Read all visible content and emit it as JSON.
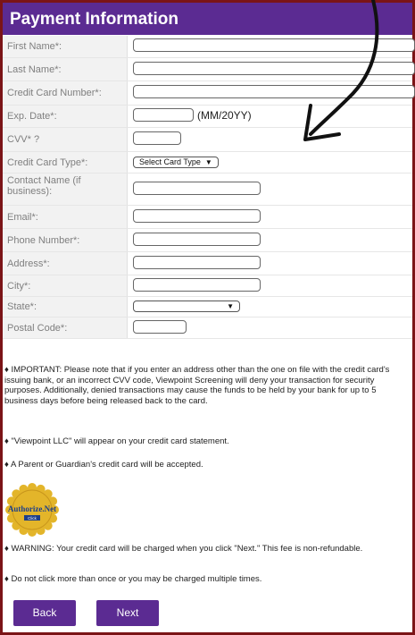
{
  "header": {
    "title": "Payment Information"
  },
  "fields": {
    "first_name": "First Name*:",
    "last_name": "Last Name*:",
    "card_number": "Credit Card Number*:",
    "exp_date": "Exp. Date*:",
    "exp_hint": "(MM/20YY)",
    "cvv": "CVV* ?",
    "card_type": "Credit Card Type*:",
    "card_type_selected": "Select Card Type",
    "contact_name": "Contact Name (if business):",
    "email": "Email*:",
    "phone": "Phone Number*:",
    "address": "Address*:",
    "city": "City*:",
    "state": "State*:",
    "postal": "Postal Code*:"
  },
  "notes": {
    "important": "♦ IMPORTANT: Please note that if you enter an address other than the one on file with the credit card's issuing bank, or an incorrect CVV code, Viewpoint Screening will deny your transaction for security purposes. Additionally, denied transactions may cause the funds to be held by your bank for up to 5 business days before being released back to the card.",
    "statement": "♦ \"Viewpoint LLC\" will appear on your credit card statement.",
    "guardian": "♦ A Parent or Guardian's credit card will be accepted.",
    "warning": "♦ WARNING: Your credit card will be charged when you click \"Next.\" This fee is non-refundable.",
    "once": "♦ Do not click more than once or you may be charged multiple times."
  },
  "badge": {
    "line1": "Authorize.Net",
    "line2": "Click"
  },
  "buttons": {
    "back": "Back",
    "next": "Next"
  },
  "colors": {
    "header": "#5b2b92",
    "button": "#5b2b92",
    "frame": "#7b1417",
    "badge": "#e3b52a"
  }
}
